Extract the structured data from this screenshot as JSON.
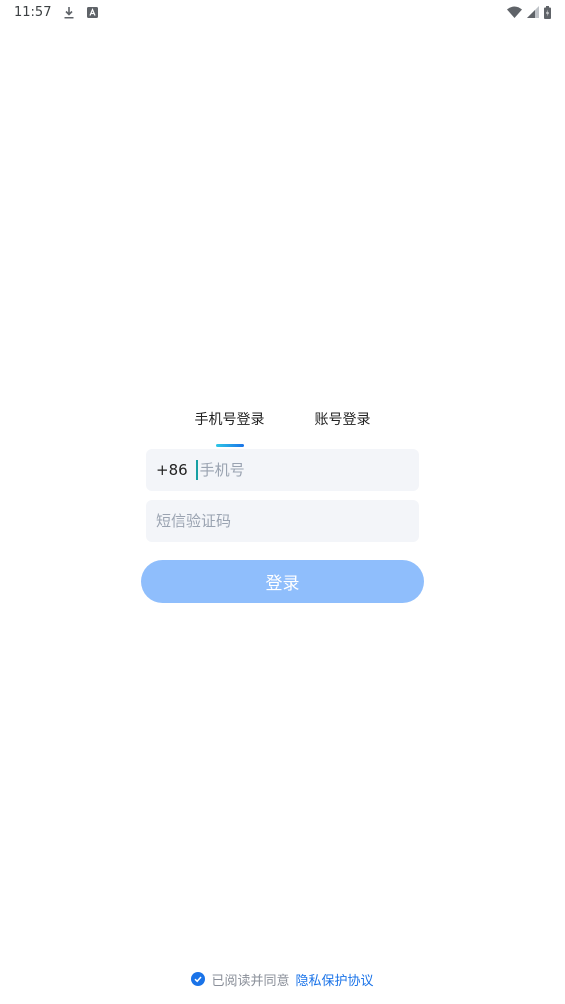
{
  "status_bar": {
    "time": "11:57",
    "icons": [
      "download-icon",
      "a-notification-icon",
      "wifi-icon",
      "signal-icon",
      "battery-icon"
    ]
  },
  "tabs": [
    {
      "label": "手机号登录",
      "active": true
    },
    {
      "label": "账号登录",
      "active": false
    }
  ],
  "phone_field": {
    "country_code": "+86",
    "placeholder": "手机号",
    "value": ""
  },
  "sms_field": {
    "placeholder": "短信验证码",
    "value": ""
  },
  "login_button": {
    "label": "登录"
  },
  "agreement": {
    "text": "已阅读并同意",
    "link": "隐私保护协议",
    "checked": true
  },
  "colors": {
    "accent": "#1a73e8",
    "button": "#8fbefc",
    "field_bg": "#f3f5f9",
    "caret": "#17a0a4"
  }
}
